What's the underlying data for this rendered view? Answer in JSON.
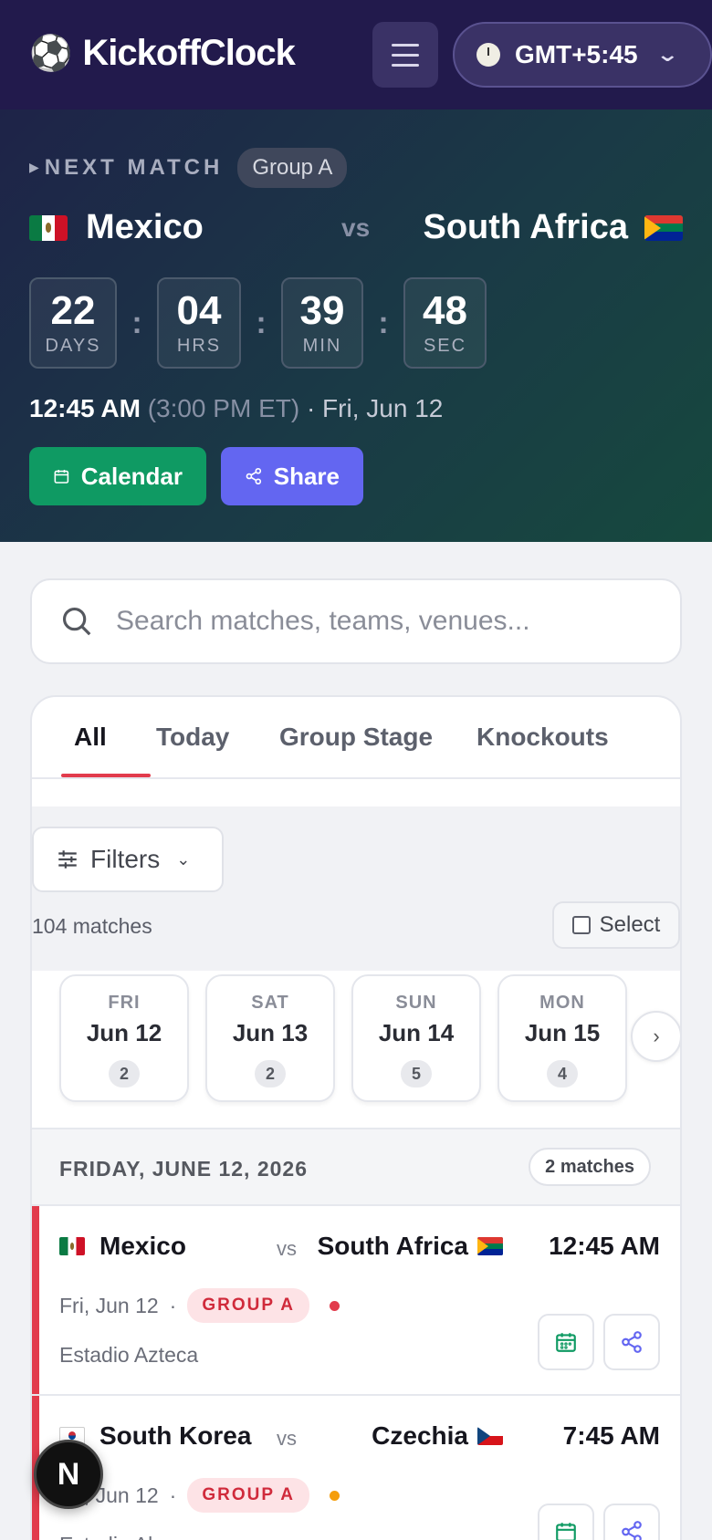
{
  "header": {
    "brand": "KickoffClock",
    "brand_icon": "soccer-ball-icon",
    "timezone": "GMT+5:45"
  },
  "hero": {
    "label": "NEXT MATCH",
    "group": "Group A",
    "home_team": "Mexico",
    "away_team": "South Africa",
    "vs": "vs",
    "countdown": [
      {
        "value": "22",
        "unit": "DAYS"
      },
      {
        "value": "04",
        "unit": "HRS"
      },
      {
        "value": "39",
        "unit": "MIN"
      },
      {
        "value": "48",
        "unit": "SEC"
      }
    ],
    "separator": ":",
    "local_time": "12:45 AM",
    "et_time": "(3:00 PM ET)",
    "date": "· Fri, Jun 12",
    "calendar_label": "Calendar",
    "share_label": "Share"
  },
  "search": {
    "placeholder": "Search matches, teams, venues..."
  },
  "tabs": [
    "All",
    "Today",
    "Group Stage",
    "Knockouts"
  ],
  "filters": {
    "label": "Filters",
    "count_text": "104 matches",
    "select_label": "Select"
  },
  "dates": [
    {
      "dow": "FRI",
      "date": "Jun 12",
      "count": "2"
    },
    {
      "dow": "SAT",
      "date": "Jun 13",
      "count": "2"
    },
    {
      "dow": "SUN",
      "date": "Jun 14",
      "count": "5"
    },
    {
      "dow": "MON",
      "date": "Jun 15",
      "count": "4"
    }
  ],
  "day": {
    "title": "FRIDAY, JUNE 12, 2026",
    "count": "2 matches"
  },
  "matches": [
    {
      "home": "Mexico",
      "away": "South Africa",
      "vs": "vs",
      "time": "12:45 AM",
      "date": "Fri, Jun 12",
      "sep": "·",
      "group": "GROUP A",
      "venue": "Estadio Azteca",
      "dot_color": "#e23b4c"
    },
    {
      "home": "South Korea",
      "away": "Czechia",
      "vs": "vs",
      "time": "7:45 AM",
      "date": "Fri, Jun 12",
      "sep": "·",
      "group": "GROUP A",
      "venue": "Estadio Akron",
      "dot_color": "#f59e0b"
    }
  ],
  "fab": "N",
  "colors": {
    "accent_red": "#e23b4c",
    "calendar_green": "#0f9a63",
    "share_indigo": "#6366f1",
    "header_bg": "#221a4c"
  }
}
